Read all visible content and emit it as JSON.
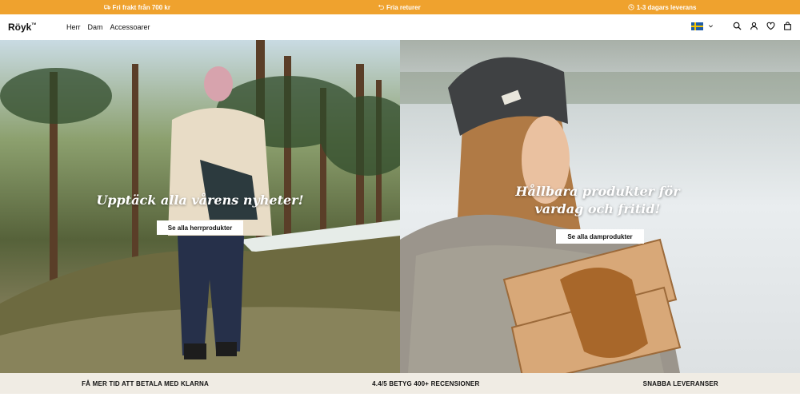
{
  "announcement": {
    "items": [
      {
        "icon": "truck-icon",
        "text": "Fri frakt från 700 kr"
      },
      {
        "icon": "return-icon",
        "text": "Fria returer"
      },
      {
        "icon": "clock-icon",
        "text": "1-3 dagars leverans"
      }
    ],
    "background": "#efa22e"
  },
  "header": {
    "logo": "Röyk",
    "logo_mark": "TM",
    "nav": [
      "Herr",
      "Dam",
      "Accessoarer"
    ],
    "language_flag": "sweden-flag-icon",
    "icons": [
      "search-icon",
      "account-icon",
      "heart-icon",
      "bag-icon"
    ]
  },
  "hero": {
    "left": {
      "title": "Upptäck alla vårens nyheter!",
      "cta": "Se alla herrprodukter"
    },
    "right": {
      "title": "Hållbara produkter för vardag och fritid!",
      "cta": "Se alla damprodukter"
    }
  },
  "usp_bar": {
    "items": [
      "FÅ MER TID ATT BETALA MED KLARNA",
      "4.4/5 BETYG 400+ RECENSIONER",
      "SNABBA LEVERANSER"
    ],
    "background": "#f0ece4"
  }
}
